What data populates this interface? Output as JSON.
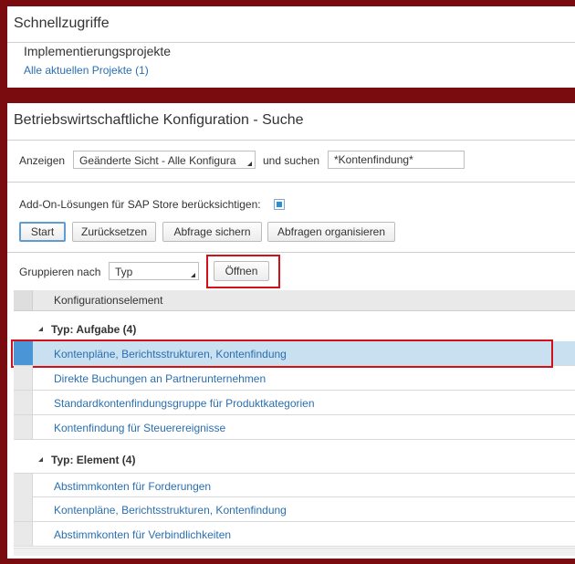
{
  "quick_access": {
    "title": "Schnellzugriffe",
    "subtitle": "Implementierungsprojekte",
    "link": "Alle aktuellen Projekte (1)"
  },
  "config_search": {
    "title": "Betriebswirtschaftliche Konfiguration - Suche",
    "show_label": "Anzeigen",
    "show_value": "Geänderte Sicht - Alle Konfigura",
    "search_label": "und suchen",
    "search_value": "*Kontenfindung*",
    "addon_label": "Add-On-Lösungen für SAP Store berücksichtigen:",
    "addon_checked": true,
    "buttons": {
      "start": "Start",
      "reset": "Zurücksetzen",
      "save_query": "Abfrage sichern",
      "organize_queries": "Abfragen organisieren"
    },
    "group_by_label": "Gruppieren nach",
    "group_by_value": "Typ",
    "open_button": "Öffnen",
    "table": {
      "column_header": "Konfigurationselement",
      "groups": [
        {
          "label": "Typ: Aufgabe (4)",
          "rows": [
            "Kontenpläne, Berichtsstrukturen, Kontenfindung",
            "Direkte Buchungen an Partnerunternehmen",
            "Standardkontenfindungsgruppe für Produktkategorien",
            "Kontenfindung für Steuerereignisse"
          ]
        },
        {
          "label": "Typ: Element (4)",
          "rows": [
            "Abstimmkonten für Forderungen",
            "Kontenpläne, Berichtsstrukturen, Kontenfindung",
            "Abstimmkonten für Verbindlichkeiten"
          ]
        }
      ]
    }
  },
  "colors": {
    "background": "#7a0c10",
    "link": "#2a6fb0",
    "selected_row": "#c9e0f1",
    "highlight": "#d0111b"
  }
}
